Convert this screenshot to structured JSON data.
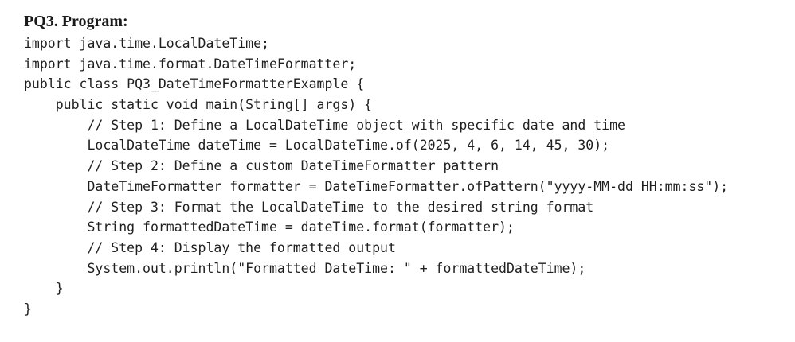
{
  "heading": "PQ3. Program:",
  "code_lines": [
    "import java.time.LocalDateTime;",
    "import java.time.format.DateTimeFormatter;",
    "public class PQ3_DateTimeFormatterExample {",
    "    public static void main(String[] args) {",
    "        // Step 1: Define a LocalDateTime object with specific date and time",
    "        LocalDateTime dateTime = LocalDateTime.of(2025, 4, 6, 14, 45, 30);",
    "        // Step 2: Define a custom DateTimeFormatter pattern",
    "        DateTimeFormatter formatter = DateTimeFormatter.ofPattern(\"yyyy-MM-dd HH:mm:ss\");",
    "        // Step 3: Format the LocalDateTime to the desired string format",
    "        String formattedDateTime = dateTime.format(formatter);",
    "        // Step 4: Display the formatted output",
    "        System.out.println(\"Formatted DateTime: \" + formattedDateTime);",
    "    }",
    "}"
  ]
}
